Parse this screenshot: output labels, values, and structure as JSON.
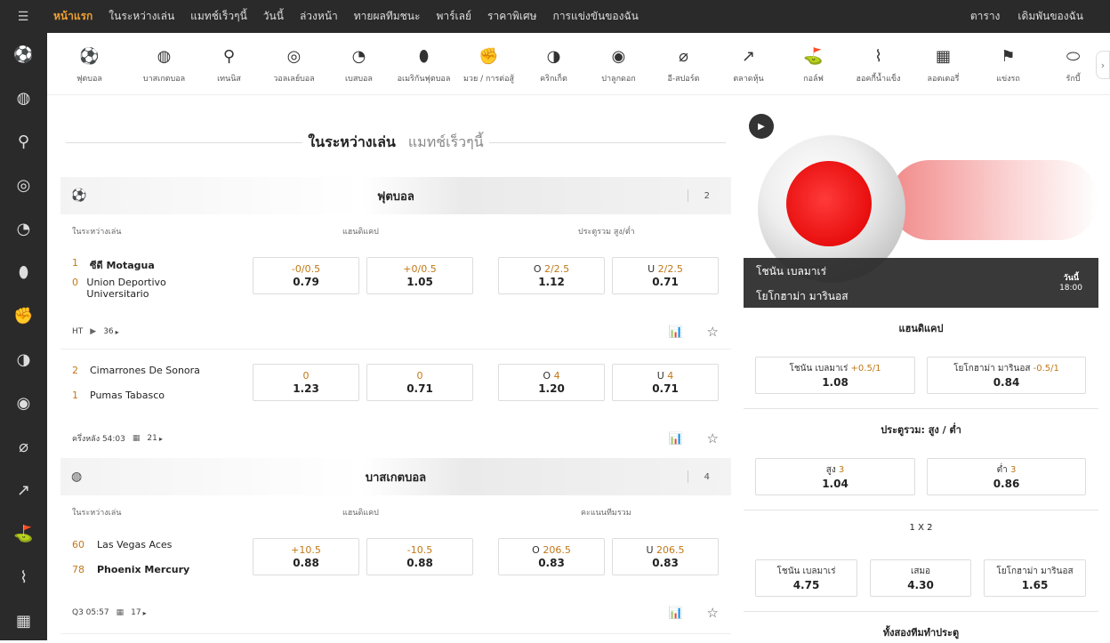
{
  "topnav": {
    "items": [
      "หน้าแรก",
      "ในระหว่างเล่น",
      "แมทช์เร็วๆนี้",
      "วันนี้",
      "ล่วงหน้า",
      "ทายผลทีมชนะ",
      "พาร์เลย์",
      "ราคาพิเศษ",
      "การแข่งขันของฉัน"
    ],
    "right": [
      "ตาราง",
      "เดิมพันของฉัน"
    ]
  },
  "sports": [
    {
      "label": "ฟุตบอล",
      "icon": "soccer-icon"
    },
    {
      "label": "บาสเกตบอล",
      "icon": "basketball-icon"
    },
    {
      "label": "เทนนิส",
      "icon": "tennis-icon"
    },
    {
      "label": "วอลเลย์บอล",
      "icon": "volleyball-icon"
    },
    {
      "label": "เบสบอล",
      "icon": "baseball-icon"
    },
    {
      "label": "อเมริกันฟุตบอล",
      "icon": "american-football-icon"
    },
    {
      "label": "มวย / การต่อสู้",
      "icon": "boxing-icon"
    },
    {
      "label": "คริกเก็ต",
      "icon": "cricket-icon"
    },
    {
      "label": "ปาลูกดอก",
      "icon": "darts-icon"
    },
    {
      "label": "อี-สปอร์ต",
      "icon": "esports-icon"
    },
    {
      "label": "ตลาดหุ้น",
      "icon": "stock-market-icon"
    },
    {
      "label": "กอล์ฟ",
      "icon": "golf-icon"
    },
    {
      "label": "ฮอคกี้น้ำแข็ง",
      "icon": "ice-hockey-icon"
    },
    {
      "label": "ลอตเตอรี่",
      "icon": "lottery-icon"
    },
    {
      "label": "แข่งรถ",
      "icon": "racing-icon"
    },
    {
      "label": "รักบี้",
      "icon": "rugby-icon"
    }
  ],
  "tabs": {
    "inplay": "ในระหว่างเล่น",
    "upcoming": "แมทช์เร็วๆนี้"
  },
  "soccer": {
    "title": "ฟุตบอล",
    "count": "2",
    "col_inplay": "ในระหว่างเล่น",
    "col_hdp": "แฮนดิแคป",
    "col_ou": "ประตูรวม สูง/ต่ำ",
    "matches": [
      {
        "home": {
          "score": "1",
          "name": "ซีดี Motagua"
        },
        "away": {
          "score": "0",
          "name": "Union Deportivo Universitario"
        },
        "odds": [
          {
            "line": "-0/0.5",
            "pre": "",
            "price": "0.79"
          },
          {
            "line": "+0/0.5",
            "pre": "",
            "price": "1.05"
          },
          {
            "line": "2/2.5",
            "pre": "O ",
            "price": "1.12"
          },
          {
            "line": "2/2.5",
            "pre": "U ",
            "price": "0.71"
          }
        ],
        "period": "HT",
        "markets": "36"
      },
      {
        "home": {
          "score": "2",
          "name": "Cimarrones De Sonora"
        },
        "away": {
          "score": "1",
          "name": "Pumas Tabasco"
        },
        "odds": [
          {
            "line": "0",
            "pre": "",
            "price": "1.23"
          },
          {
            "line": "0",
            "pre": "",
            "price": "0.71"
          },
          {
            "line": "4",
            "pre": "O ",
            "price": "1.20"
          },
          {
            "line": "4",
            "pre": "U ",
            "price": "0.71"
          }
        ],
        "period": "ครึ่งหลัง 54:03",
        "markets": "21"
      }
    ]
  },
  "basketball": {
    "title": "บาสเกตบอล",
    "count": "4",
    "col_inplay": "ในระหว่างเล่น",
    "col_hdp": "แฮนดิแคป",
    "col_ou": "คะแนนทีมรวม",
    "match": {
      "home": {
        "score": "60",
        "name": "Las Vegas Aces"
      },
      "away": {
        "score": "78",
        "name": "Phoenix Mercury"
      },
      "odds": [
        {
          "line": "+10.5",
          "pre": "",
          "price": "0.88"
        },
        {
          "line": "-10.5",
          "pre": "",
          "price": "0.88"
        },
        {
          "line": "206.5",
          "pre": "O ",
          "price": "0.83"
        },
        {
          "line": "206.5",
          "pre": "U ",
          "price": "0.83"
        }
      ],
      "period": "Q3 05:57",
      "markets": "17"
    }
  },
  "featured": {
    "home": "โชนัน เบลมาเร่",
    "away": "โยโกฮาม่า มารินอส",
    "day": "วันนี้",
    "time": "18:00",
    "hdp_title": "แฮนดิแคป",
    "hdp": [
      {
        "name": "โชนัน เบลมาเร่ ",
        "line": "+0.5/1",
        "price": "1.08"
      },
      {
        "name": "โยโกฮาม่า มารินอส ",
        "line": "-0.5/1",
        "price": "0.84"
      }
    ],
    "ou_title": "ประตูรวม: สูง / ต่ำ",
    "ou": [
      {
        "name": "สูง ",
        "line": "3",
        "price": "1.04"
      },
      {
        "name": "ต่ำ ",
        "line": "3",
        "price": "0.86"
      }
    ],
    "x12_title": "1 X 2",
    "x12": [
      {
        "name": "โชนัน เบลมาเร่",
        "price": "4.75"
      },
      {
        "name": "เสมอ",
        "price": "4.30"
      },
      {
        "name": "โยโกฮาม่า มารินอส",
        "price": "1.65"
      }
    ],
    "bts_title": "ทั้งสองทีมทำประตู"
  }
}
